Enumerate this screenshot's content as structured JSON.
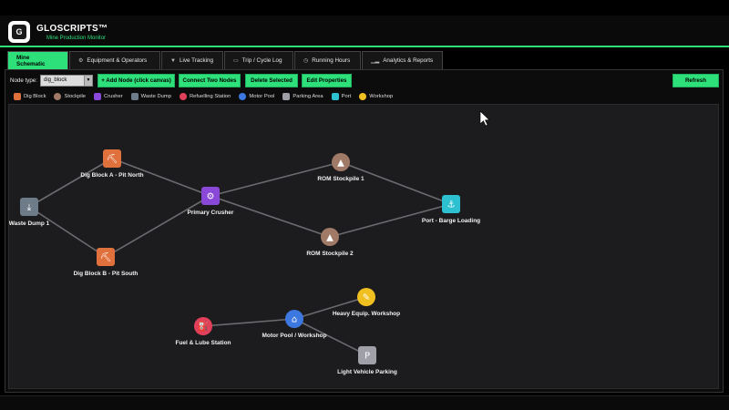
{
  "app": {
    "title": "GLOSCRIPTS™",
    "subtitle": "Mine Production Monitor",
    "logo_text": "G"
  },
  "tabs": [
    {
      "label": "Mine Schematic",
      "icon": ""
    },
    {
      "label": "Equipment & Operators",
      "icon": "⚙"
    },
    {
      "label": "Live Tracking",
      "icon": "▼"
    },
    {
      "label": "Trip / Cycle Log",
      "icon": "▭"
    },
    {
      "label": "Running Hours",
      "icon": "◷"
    },
    {
      "label": "Analytics & Reports",
      "icon": "▁▂"
    }
  ],
  "toolbar": {
    "node_type_label": "Node type:",
    "node_type_value": "dig_block",
    "add_node": "+ Add Node (click canvas)",
    "connect": "Connect Two Nodes",
    "delete": "Delete Selected",
    "edit": "Edit Properties",
    "refresh": "Refresh"
  },
  "legend": [
    {
      "label": "Dig Block",
      "color": "#e0703c",
      "shape": "square"
    },
    {
      "label": "Stockpile",
      "color": "#a07a66",
      "shape": "round"
    },
    {
      "label": "Crusher",
      "color": "#8a48d8",
      "shape": "square"
    },
    {
      "label": "Waste Dump",
      "color": "#6e7c8a",
      "shape": "square"
    },
    {
      "label": "Refuelling Station",
      "color": "#e0405a",
      "shape": "round"
    },
    {
      "label": "Motor Pool",
      "color": "#3c78e0",
      "shape": "round"
    },
    {
      "label": "Parking Area",
      "color": "#a0a0a8",
      "shape": "square"
    },
    {
      "label": "Port",
      "color": "#2cc0d0",
      "shape": "square"
    },
    {
      "label": "Workshop",
      "color": "#f0c020",
      "shape": "round"
    }
  ],
  "schematic": {
    "nodes": [
      {
        "id": "waste",
        "label": "Waste Dump 1",
        "type": "waste",
        "color": "#6e7c8a",
        "shape": "square",
        "glyph": "⤓"
      },
      {
        "id": "digA",
        "label": "Dig Block A - Pit North",
        "type": "dig",
        "color": "#e0703c",
        "shape": "square",
        "glyph": "⛏"
      },
      {
        "id": "digB",
        "label": "Dig Block B - Pit South",
        "type": "dig",
        "color": "#e0703c",
        "shape": "square",
        "glyph": "⛏"
      },
      {
        "id": "crusher",
        "label": "Primary Crusher",
        "type": "crusher",
        "color": "#8a48d8",
        "shape": "square",
        "glyph": "⚙"
      },
      {
        "id": "rom1",
        "label": "ROM Stockpile 1",
        "type": "stockpile",
        "color": "#a07a66",
        "shape": "round",
        "glyph": "▲"
      },
      {
        "id": "rom2",
        "label": "ROM Stockpile 2",
        "type": "stockpile",
        "color": "#a07a66",
        "shape": "round",
        "glyph": "▲"
      },
      {
        "id": "port",
        "label": "Port - Barge Loading",
        "type": "port",
        "color": "#2cc0d0",
        "shape": "square",
        "glyph": "⚓"
      },
      {
        "id": "fuel",
        "label": "Fuel & Lube Station",
        "type": "fuel",
        "color": "#e0405a",
        "shape": "round",
        "glyph": "⛽"
      },
      {
        "id": "motor",
        "label": "Motor Pool / Workshop",
        "type": "motorpool",
        "color": "#3c78e0",
        "shape": "round",
        "glyph": "⌂"
      },
      {
        "id": "heavy",
        "label": "Heavy Equip. Workshop",
        "type": "workshop",
        "color": "#f0c020",
        "shape": "round",
        "glyph": "✎"
      },
      {
        "id": "parking",
        "label": "Light Vehicle Parking",
        "type": "parking",
        "color": "#a0a0a8",
        "shape": "square",
        "glyph": "P"
      }
    ],
    "edges": [
      [
        "waste",
        "digA"
      ],
      [
        "waste",
        "digB"
      ],
      [
        "digA",
        "crusher"
      ],
      [
        "digB",
        "crusher"
      ],
      [
        "crusher",
        "rom1"
      ],
      [
        "crusher",
        "rom2"
      ],
      [
        "rom1",
        "port"
      ],
      [
        "rom2",
        "port"
      ],
      [
        "fuel",
        "motor"
      ],
      [
        "motor",
        "heavy"
      ],
      [
        "motor",
        "parking"
      ]
    ]
  }
}
